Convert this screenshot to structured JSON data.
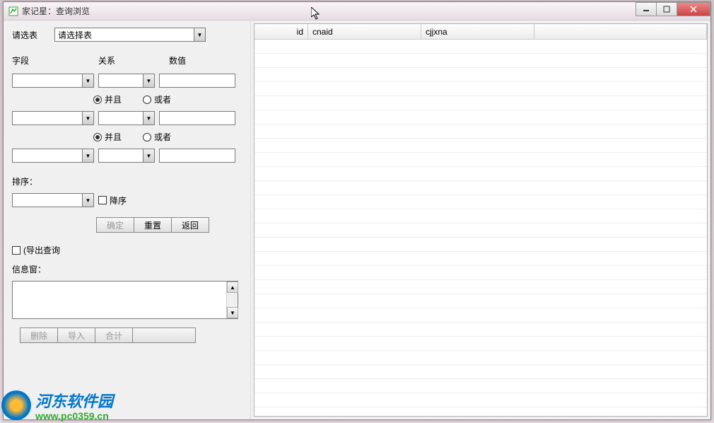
{
  "window": {
    "title": "家记星：查询浏览"
  },
  "leftPanel": {
    "selectTableLabel": "请选表",
    "selectTablePlaceholder": "请选择表",
    "fieldLabel": "字段",
    "relationLabel": "关系",
    "valueLabel": "数值",
    "andLabel": "并且",
    "orLabel": "或者",
    "sortLabel": "排序：",
    "descLabel": "降序",
    "okBtn": "确定",
    "resetBtn": "重置",
    "backBtn": "返回",
    "exportCheckLabel": "(导出查询",
    "msgLabel": "信息窗：",
    "deleteBtn": "删除",
    "importBtn": "导入",
    "totalBtn": "合计"
  },
  "grid": {
    "headers": [
      "id",
      "cnaid",
      "cjjxna"
    ]
  },
  "watermark": {
    "name": "河东软件园",
    "url": "www.pc0359.cn"
  }
}
